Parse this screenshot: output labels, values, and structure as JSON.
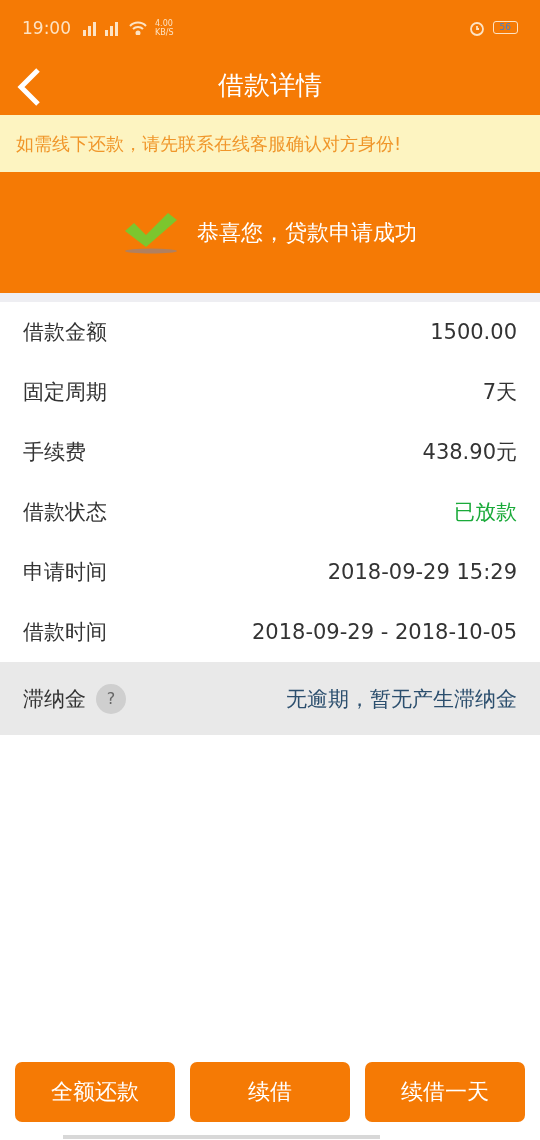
{
  "status_bar": {
    "time": "19:00",
    "speed": "4.00",
    "speed_unit": "KB/S",
    "battery": "56"
  },
  "nav": {
    "title": "借款详情"
  },
  "notice": "如需线下还款，请先联系在线客服确认对方身份!",
  "success": "恭喜您，贷款申请成功",
  "rows": [
    {
      "kind": "plain",
      "label": "借款金额",
      "value": "1500.00"
    },
    {
      "kind": "plain",
      "label": "固定周期",
      "value": "7天"
    },
    {
      "kind": "plain",
      "label": "手续费",
      "value": "438.90元"
    },
    {
      "kind": "status",
      "label": "借款状态",
      "value": "已放款"
    },
    {
      "kind": "plain",
      "label": "申请时间",
      "value": "2018-09-29 15:29"
    },
    {
      "kind": "plain",
      "label": "借款时间",
      "value": "2018-09-29 - 2018-10-05"
    },
    {
      "kind": "note",
      "label": "滞纳金",
      "help": "?",
      "value": "无逾期，暂无产生滞纳金"
    }
  ],
  "buttons": [
    "全额还款",
    "续借",
    "续借一天"
  ]
}
